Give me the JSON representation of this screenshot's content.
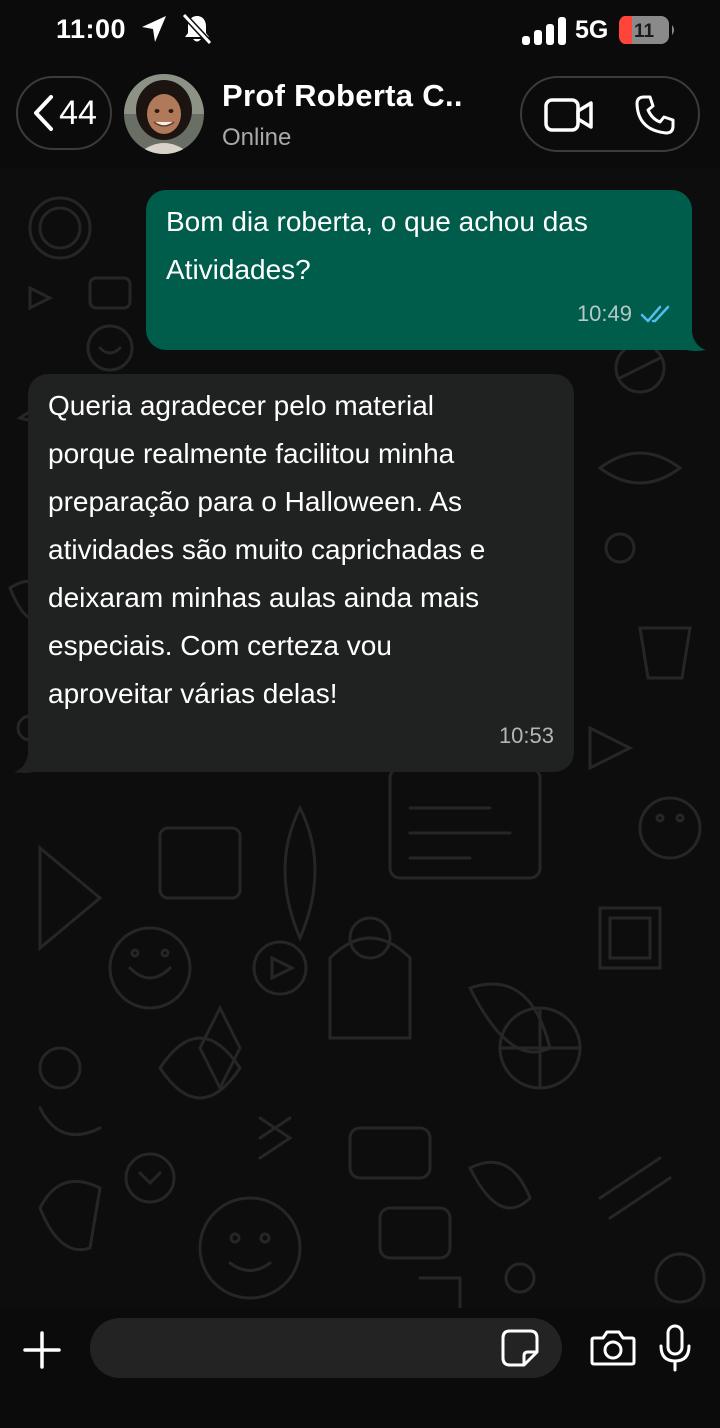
{
  "status_bar": {
    "time": "11:00",
    "network": "5G",
    "battery": "11"
  },
  "header": {
    "back_count": "44",
    "contact_name": "Prof Roberta C..",
    "contact_status": "Online"
  },
  "messages": [
    {
      "direction": "outgoing",
      "text": "Bom dia roberta, o que achou das\nAtividades?",
      "time": "10:49",
      "status": "read"
    },
    {
      "direction": "incoming",
      "text": "Queria agradecer pelo material\nporque realmente facilitou minha\npreparação para o Halloween. As\natividades são muito caprichadas e\ndeixaram minhas aulas ainda mais\nespeciais. Com certeza vou\naproveitar várias delas!",
      "time": "10:53"
    }
  ],
  "composer": {
    "placeholder": ""
  },
  "colors": {
    "outgoing_bubble": "#005c4b",
    "incoming_bubble": "#202221",
    "read_ticks": "#53bdeb",
    "battery_low": "#ff453a"
  },
  "icons": [
    "location-arrow-icon",
    "bell-muted-icon",
    "signal-icon",
    "battery-icon",
    "chevron-left-icon",
    "video-icon",
    "phone-icon",
    "double-check-icon",
    "plus-icon",
    "sticker-icon",
    "camera-icon",
    "microphone-icon"
  ]
}
